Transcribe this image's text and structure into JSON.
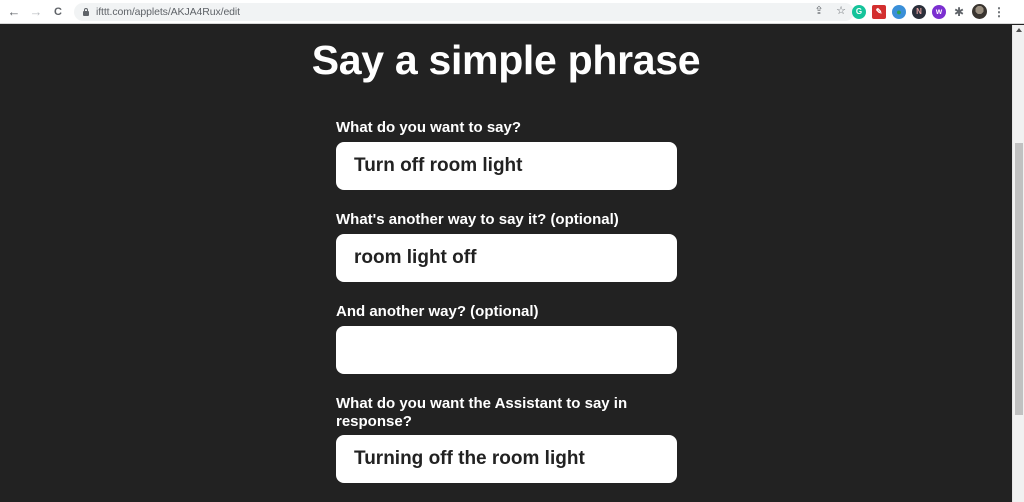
{
  "browser": {
    "url": "ifttt.com/applets/AKJA4Rux/edit",
    "nav": {
      "back_icon": "←",
      "forward_icon": "→",
      "reload_icon": "C"
    },
    "omnibox_icons": {
      "share_icon": "⇪",
      "star_icon": "☆"
    },
    "extensions": [
      {
        "name": "grammarly",
        "glyph": "G",
        "color": "#15c39a"
      },
      {
        "name": "pdf",
        "glyph": "✎",
        "color": "#d32f2f"
      },
      {
        "name": "globe",
        "glyph": "●",
        "color": "#3a8fd8"
      },
      {
        "name": "dark-ext",
        "glyph": "N",
        "color": "#2b2f3a"
      },
      {
        "name": "purple-ext",
        "glyph": "w",
        "color": "#7b2fd0"
      }
    ],
    "puzzle_icon": "✱",
    "menu_icon": "⋮"
  },
  "page": {
    "title": "Say a simple phrase",
    "fields": [
      {
        "label": "What do you want to say?",
        "value": "Turn off room light"
      },
      {
        "label": "What's another way to say it? (optional)",
        "value": "room light off"
      },
      {
        "label": "And another way? (optional)",
        "value": ""
      },
      {
        "label": "What do you want the Assistant to say in response?",
        "value": "Turning off the room light"
      }
    ]
  }
}
